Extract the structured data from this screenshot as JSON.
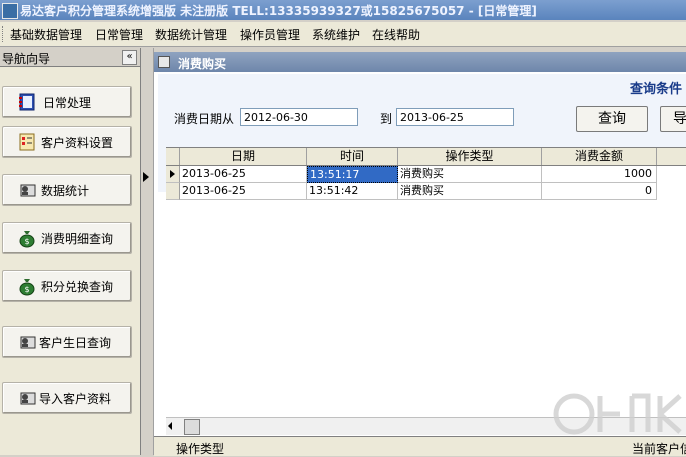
{
  "window": {
    "title": "易达客户积分管理系统增强版 未注册版 TELL:13335939327或15825675057 - [日常管理]"
  },
  "menu": [
    {
      "label": "基础数据管理"
    },
    {
      "label": "日常管理"
    },
    {
      "label": "数据统计管理"
    },
    {
      "label": "操作员管理"
    },
    {
      "label": "系统维护"
    },
    {
      "label": "在线帮助"
    }
  ],
  "nav": {
    "title": "导航向导",
    "collapse_label": "«",
    "items": [
      {
        "label": "日常处理",
        "icon": "notebook-icon"
      },
      {
        "label": "客户资料设置",
        "icon": "checklist-icon"
      },
      {
        "label": "数据统计",
        "icon": "user-card-icon"
      },
      {
        "label": "消费明细查询",
        "icon": "money-bag-icon"
      },
      {
        "label": "积分兑换查询",
        "icon": "money-bag-icon"
      },
      {
        "label": "客户生日查询",
        "icon": "user-card-icon"
      },
      {
        "label": "导入客户资料",
        "icon": "user-card-icon"
      }
    ]
  },
  "panel": {
    "tab_label": "消费购买"
  },
  "query": {
    "title": "查询条件",
    "date_from_label": "消费日期从",
    "date_from_value": "2012-06-30",
    "date_to_label": "到",
    "date_to_value": "2013-06-25",
    "search_button": "查询",
    "export_button": "导"
  },
  "grid": {
    "columns": [
      "日期",
      "时间",
      "操作类型",
      "消费金额"
    ],
    "rows": [
      {
        "date": "2013-06-25",
        "time": "13:51:17",
        "type": "消费购买",
        "amount": "1000",
        "current": true
      },
      {
        "date": "2013-06-25",
        "time": "13:51:42",
        "type": "消费购买",
        "amount": "0",
        "current": false
      }
    ]
  },
  "status": {
    "left": "操作类型",
    "right": "当前客户信"
  },
  "colors": {
    "selection": "#316ac5",
    "title_accent": "#1a3c8a"
  }
}
